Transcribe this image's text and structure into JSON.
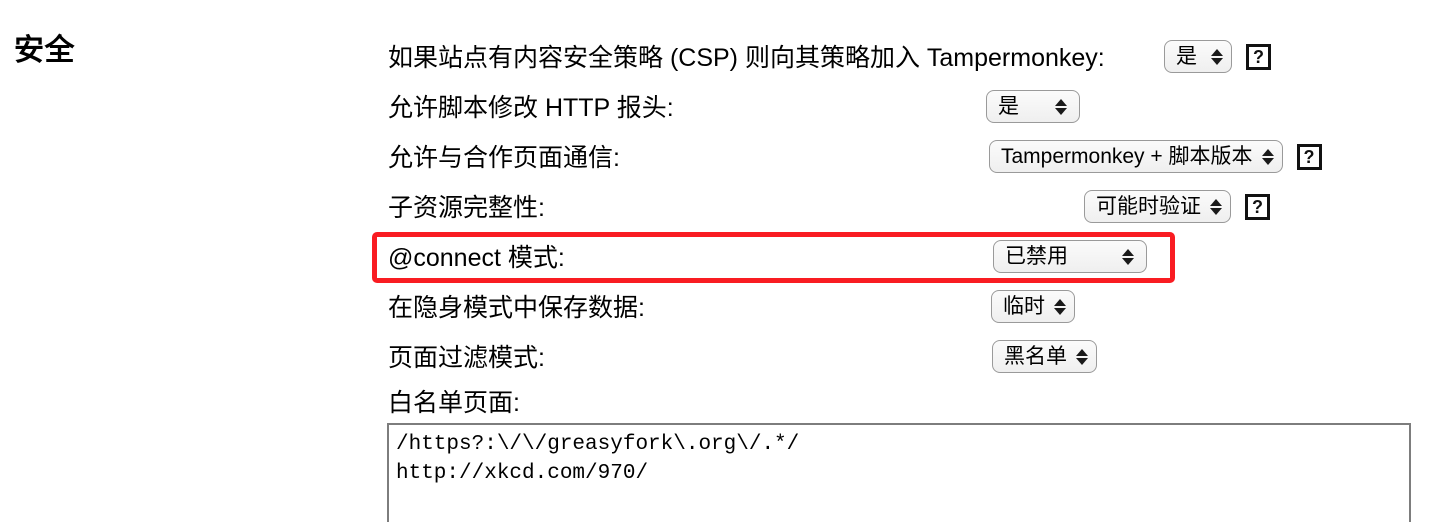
{
  "section": {
    "title": "安全"
  },
  "rows": [
    {
      "label": "如果站点有内容安全策略 (CSP) 则向其策略加入 Tampermonkey:",
      "select_value": "是",
      "help_label": "?",
      "has_help": true
    },
    {
      "label": "允许脚本修改 HTTP 报头:",
      "select_value": "是",
      "help_label": "?",
      "has_help": false
    },
    {
      "label": "允许与合作页面通信:",
      "select_value": "Tampermonkey + 脚本版本",
      "help_label": "?",
      "has_help": true
    },
    {
      "label": "子资源完整性:",
      "select_value": "可能时验证",
      "help_label": "?",
      "has_help": true
    },
    {
      "label": "@connect 模式:",
      "select_value": "已禁用",
      "help_label": "?",
      "has_help": false
    },
    {
      "label": "在隐身模式中保存数据:",
      "select_value": "临时",
      "help_label": "?",
      "has_help": false
    },
    {
      "label": "页面过滤模式:",
      "select_value": "黑名单",
      "help_label": "?",
      "has_help": false
    }
  ],
  "whitelist": {
    "label": "白名单页面:",
    "value": "/https?:\\/\\/greasyfork\\.org\\/.*/\nhttp://xkcd.com/970/",
    "placeholder": ""
  },
  "annotation": {
    "highlight_color": "#f91c22",
    "highlighted_row_label": "@connect 模式:"
  }
}
